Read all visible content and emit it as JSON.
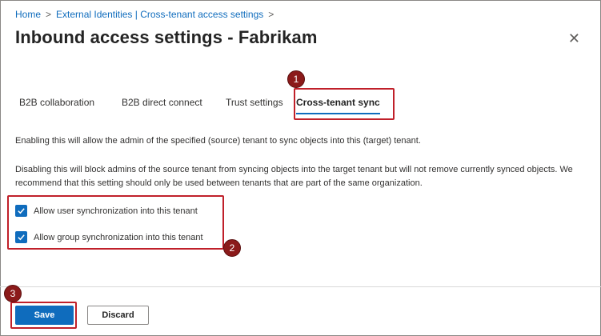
{
  "breadcrumb": {
    "home": "Home",
    "separator": ">",
    "parent": "External Identities | Cross-tenant access settings"
  },
  "page": {
    "title": "Inbound access settings - Fabrikam",
    "more": "···",
    "close": "✕"
  },
  "tabs": [
    {
      "label": "B2B collaboration"
    },
    {
      "label": "B2B direct connect"
    },
    {
      "label": "Trust settings"
    },
    {
      "label": "Cross-tenant sync",
      "active": true
    }
  ],
  "content": {
    "enable_text": "Enabling this will allow the admin of the specified (source) tenant to sync objects into this (target) tenant.",
    "disable_text": "Disabling this will block admins of the source tenant from syncing objects into the target tenant but will not remove currently synced objects. We recommend that this setting should only be used between tenants that are part of the same organization.",
    "checkboxes": [
      {
        "label": "Allow user synchronization into this tenant",
        "checked": true
      },
      {
        "label": "Allow group synchronization into this tenant",
        "checked": true
      }
    ]
  },
  "footer": {
    "save_label": "Save",
    "discard_label": "Discard"
  },
  "annotations": {
    "step1": "1",
    "step2": "2",
    "step3": "3",
    "color": "#c0202a"
  },
  "colors": {
    "accent": "#0f6cbd",
    "badge": "#8b1a1a"
  }
}
